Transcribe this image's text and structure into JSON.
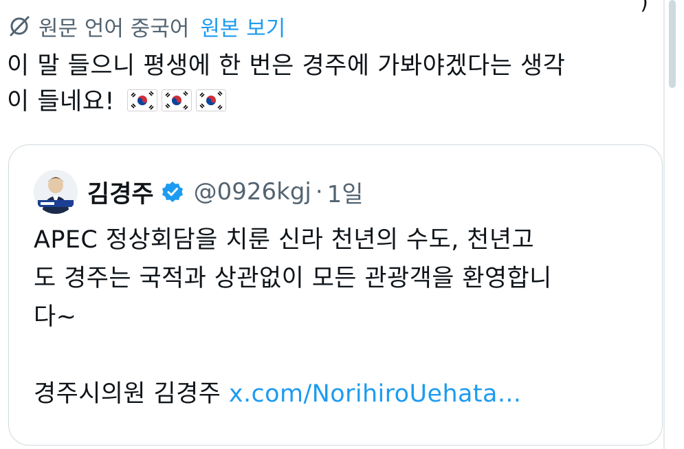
{
  "translation": {
    "icon": "translate-slash-icon",
    "label": "원문 언어 중국어",
    "view_original": "원본 보기"
  },
  "tweet": {
    "text_line1": "이 말 들으니 평생에 한 번은 경주에 가봐야겠다는 생각",
    "text_line2": "이 들네요!",
    "flags": [
      "kr-flag-icon",
      "kr-flag-icon",
      "kr-flag-icon"
    ]
  },
  "quote": {
    "author_name": "김경주",
    "verified": true,
    "handle": "@0926kgj",
    "separator": "·",
    "time": "1일",
    "body_line1": "APEC 정상회담을 치룬 신라 천년의 수도, 천년고",
    "body_line2": "도 경주는 국적과 상관없이 모든 관광객을 환영합니",
    "body_line3": "다~",
    "signature": "경주시의원 김경주",
    "link": "x.com/NorihiroUehata..."
  },
  "colors": {
    "text": "#0f1419",
    "secondary": "#536471",
    "accent": "#1d9bf0",
    "border": "#cfd9de"
  }
}
